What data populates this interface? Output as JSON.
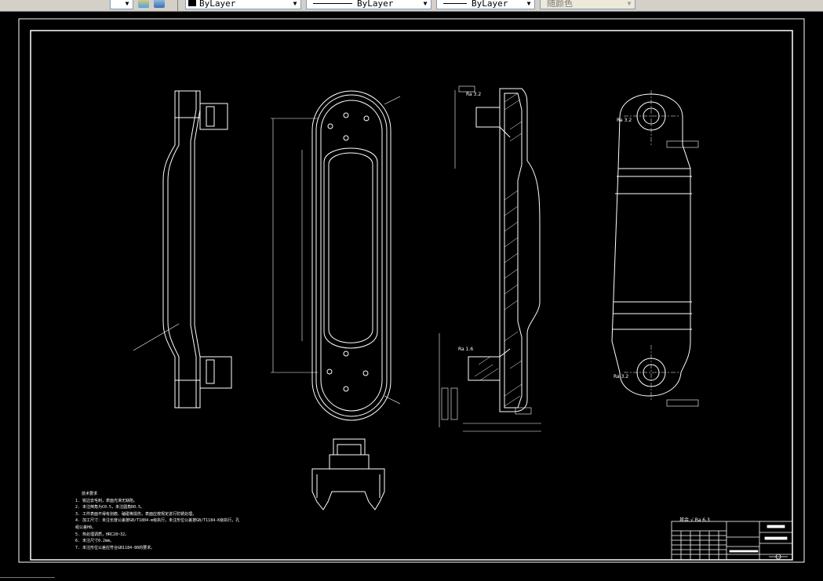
{
  "toolbar": {
    "color_value": "ByLayer",
    "linetype_value": "ByLayer",
    "lineweight_value": "ByLayer",
    "plotstyle_value": "随颜色"
  },
  "drawing": {
    "roughness_labels": [
      "Ra 3.2",
      "Ra 1.6",
      "Ra 3.2",
      "Ra 3.2"
    ],
    "surface_note": "其余",
    "surface_note_value": "Ra 6.3",
    "tech_requirements_title": "技术要求",
    "tech_requirements": [
      "1. 锐边去毛刺，表面光滑无缺陷。",
      "2. 未注倒角为C0.5，未注圆角R0.5。",
      "3. 工件表面不得有划痕、磕碰等损伤，表面应按规定进行防锈处理。",
      "4. 加工尺寸：未注长度公差按GB/T1804-m级执行，未注形位公差按GB/T1184-K级执行，孔",
      "   组公差H8。",
      "5. 热处理调质，HRC28~32。",
      "6. 未注尺寸0.2mm。",
      "7. 未注形位公差应符合GB1184-80的要求。"
    ],
    "colors": {
      "background": "#000000",
      "lines": "#ffffff"
    }
  }
}
